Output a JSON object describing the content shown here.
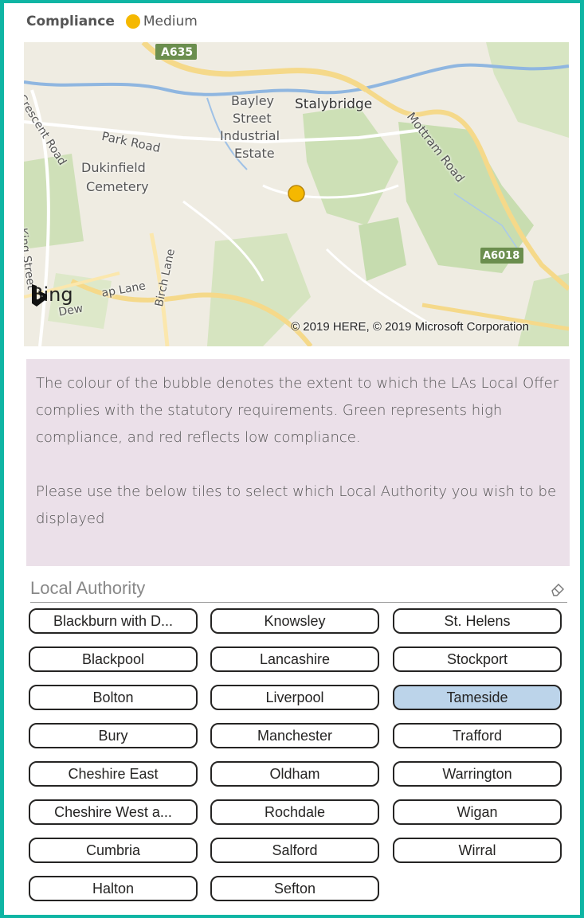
{
  "legend": {
    "label": "Compliance",
    "value": "Medium",
    "color": "#f5b800"
  },
  "map": {
    "labels": {
      "road_a635": "A635",
      "road_a6018": "A6018",
      "bayley": "Bayley",
      "street": "Street",
      "industrial": "Industrial",
      "estate": "Estate",
      "stalybridge": "Stalybridge",
      "park_road": "Park Road",
      "crescent_road": "Crescent Road",
      "dukinfield": "Dukinfield",
      "cemetery": "Cemetery",
      "mottram_road": "Mottram Road",
      "birch_lane": "Birch Lane",
      "king_street": "King Street",
      "cap_lane": "ap Lane",
      "dew": "Dew"
    },
    "brand": "Bing",
    "attribution": "© 2019 HERE, © 2019 Microsoft Corporation",
    "marker_color": "#f5b800"
  },
  "note": {
    "para1": "The colour of the bubble denotes the extent to which the LAs Local Offer complies with the statutory requirements. Green represents high compliance, and red reflects low compliance.",
    "para2": "Please use the below tiles to select which Local Authority you wish to be displayed"
  },
  "slicer": {
    "title": "Local Authority",
    "eraser_icon": "eraser-icon",
    "selected": "Tameside",
    "tiles": [
      "Blackburn with D...",
      "Knowsley",
      "St. Helens",
      "Blackpool",
      "Lancashire",
      "Stockport",
      "Bolton",
      "Liverpool",
      "Tameside",
      "Bury",
      "Manchester",
      "Trafford",
      "Cheshire East",
      "Oldham",
      "Warrington",
      "Cheshire West a...",
      "Rochdale",
      "Wigan",
      "Cumbria",
      "Salford",
      "Wirral",
      "Halton",
      "Sefton"
    ]
  }
}
